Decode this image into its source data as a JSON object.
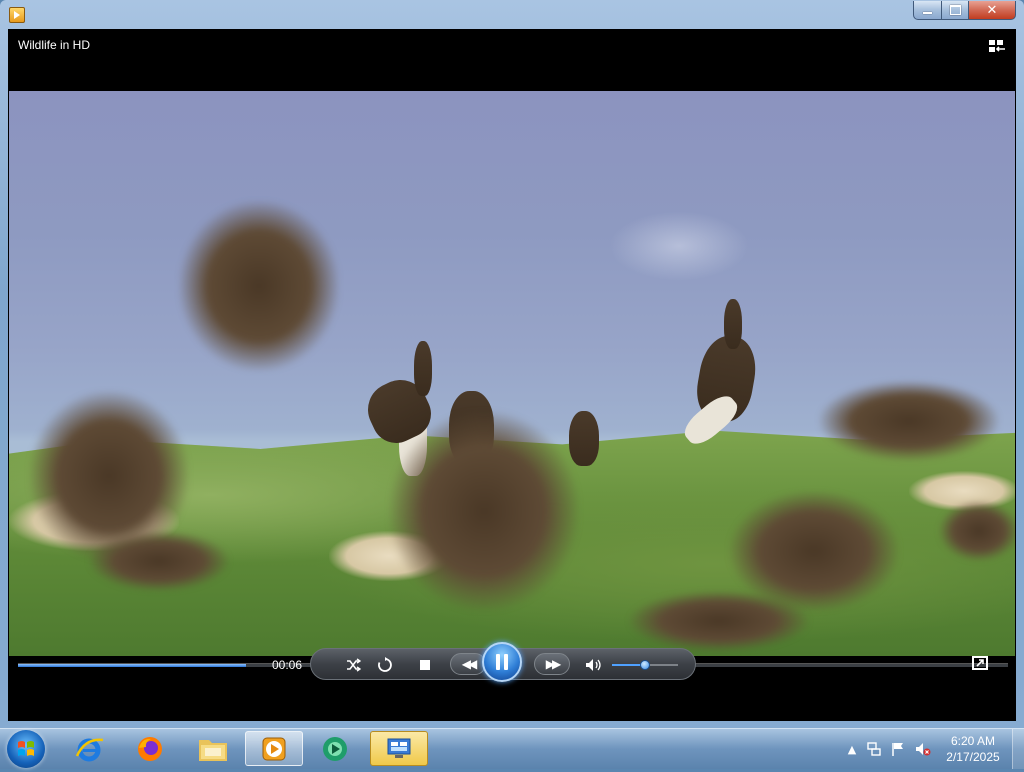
{
  "window": {
    "title_bar": {
      "minimize": "minimize-button",
      "maximize": "maximize-button",
      "close": "close-button"
    }
  },
  "player": {
    "video_title": "Wildlife in HD",
    "elapsed_time": "00:06",
    "progress_fraction": 0.23,
    "volume_fraction": 0.5,
    "controls": {
      "shuffle_icon": "shuffle-icon",
      "repeat_icon": "repeat-icon",
      "stop_icon": "stop-icon",
      "previous_icon": "previous-icon",
      "pause_icon": "pause-icon",
      "next_icon": "next-icon",
      "mute_icon": "volume-icon",
      "fullscreen_icon": "fullscreen-icon",
      "switch_to_library_icon": "switch-to-library-icon"
    },
    "accent_color": "#2f7ed6"
  },
  "taskbar": {
    "pinned": [
      {
        "name": "internet-explorer",
        "active": false
      },
      {
        "name": "firefox",
        "active": false
      },
      {
        "name": "windows-explorer",
        "active": false
      },
      {
        "name": "windows-media-player",
        "active": true
      },
      {
        "name": "windows-media-center",
        "active": false
      },
      {
        "name": "remote-desktop-app",
        "active": false
      }
    ],
    "clock": {
      "time": "6:20 AM",
      "date": "2/17/2025"
    }
  }
}
